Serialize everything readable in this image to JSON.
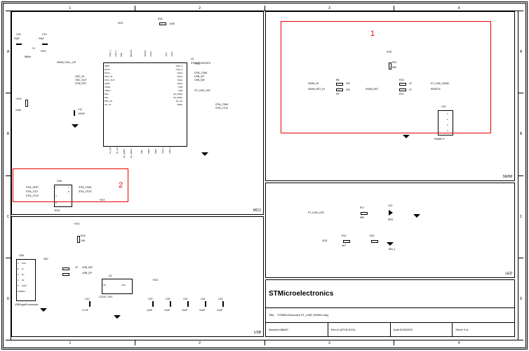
{
  "frame": {
    "cols": [
      "1",
      "2",
      "3",
      "4"
    ],
    "rows": [
      "A",
      "B",
      "C",
      "D"
    ]
  },
  "title_block": {
    "company": "STMicroelectronics",
    "title_label": "Title:",
    "title": "STM8S-Discovery ST_LINK (SWIM only)",
    "number_label": "Number:",
    "number": "MB867",
    "rev_label": "Rev:",
    "rev": "A.1(PCB.SCH)",
    "date_label": "Date:",
    "date": "6/25/2009",
    "sheet_label": "Sheet 3",
    "sheet_of": "of"
  },
  "blocks": {
    "mcu": {
      "label": "MCU",
      "ic_ref": "U2",
      "ic_part": "STM32F103C8T6"
    },
    "swim": {
      "label": "SWIM",
      "cn": "CN7",
      "cn_part": "Header 4",
      "pins": [
        "1",
        "2",
        "3",
        "4"
      ],
      "vdd": "VDD",
      "r12_val": "680",
      "r12": "R12"
    },
    "led": {
      "label": "LED",
      "ld_ref": "LD2",
      "ld_color": "RED",
      "ain1": "AIN_1"
    },
    "usb": {
      "label": "USB",
      "cn": "CN6",
      "conn_type": "USB-typeB connector",
      "reg": "U4",
      "reg_part": "LD1117-3V3",
      "reg_in": "Vin",
      "reg_out": "Vout"
    }
  },
  "highlights": {
    "one": "1",
    "two": "2"
  },
  "nets": {
    "swim_in": "SWIM_IN",
    "swim_rst_in": "SWIM_RST_IN",
    "swim_rst": "SWIM_RST",
    "st_link_swim": "ST_LINK_SWIM",
    "resetb": "RESET#",
    "st_link_led": "ST_LINK_LED",
    "vdd": "VDD",
    "r8": "R8",
    "r9": "R9",
    "r13": "R13",
    "r14": "R14",
    "r_220a": "220",
    "r_220b": "220",
    "r_47a": "47",
    "r_47b": "47",
    "r17": "R17",
    "r17_val": "680",
    "r19": "R19",
    "r19_val": "4K7",
    "r20": "R20",
    "swim_pull_up": "SWIM_PULL_UP",
    "osc_in": "OSC_IN",
    "osc_out": "OSC_OUT",
    "stm_rst": "STM_RST",
    "r18": "R18",
    "r18_val": "1K5",
    "u5v": "U5V",
    "usb_dm": "USB_DM",
    "usb_dp": "USB_DP",
    "r_22": "22",
    "p3v3": "+3V3",
    "p5v": "+5V",
    "x1": "X1",
    "x1_val": "8MHz",
    "c11": "C11",
    "c11_val": "100nF",
    "c18": "C18",
    "c18_val": "20pF",
    "c19": "C19",
    "c19_val": "20pF",
    "c10": "C10",
    "c10_val": "4.7uF",
    "c29": "C29",
    "c30": "C30",
    "c31": "C31",
    "c32": "C32",
    "c33": "C33",
    "c_val_10up": "10uP",
    "r15": "R15",
    "r15_val": "100K",
    "vcc": "VCC",
    "dm": "D-",
    "dp": "D+",
    "id": "ID",
    "gnd": "GND",
    "shell": "SHELL",
    "cn5": "CN5",
    "jtag": "JTAG",
    "stm_jrst": "STM_JRST",
    "stm_jtdi": "STM_JTDI",
    "stm_jtck": "STM_JTCK",
    "stm_jtms": "STM_JTMS",
    "stm_jtdo": "STM_JTDO",
    "vbat": "VBAT",
    "pc13": "PC13",
    "pc14": "PC14",
    "nrst": "nRST",
    "vssa": "VSSA",
    "vdda": "VDDA",
    "pa0": "PA0",
    "pa1": "PA1",
    "mis_cs": "MIS_CS",
    "vdd3": "VDD_3",
    "vss3": "VSS_3",
    "pb9": "PB9",
    "boot0": "BOOT0",
    "jnrst": "JNRST",
    "jtdo": "JTDO",
    "jtdi": "JTDI",
    "jtck": "JTCK",
    "vdd2": "VDD_2",
    "vss2": "VSS_2",
    "pa13": "PA13",
    "pa12": "PA12",
    "pa11": "PA11",
    "pa10": "PA10",
    "pa9": "PA9",
    "pa8": "PA8",
    "s2_mosi": "S2_MOSI",
    "s2_miso": "S2_MISO",
    "s2_ck": "S2_CK",
    "pb12": "PB12",
    "usb_dp_n": "USB_DP",
    "usb_dm_n": "USB_DM",
    "u2_tx": "U2_TX",
    "u2_rx": "U2_RX",
    "s1_ck": "S1_CK",
    "s1_miso": "S1_MISO",
    "s1_mosi": "S1_MOSI",
    "pb1": "PB1",
    "pb10": "PB10",
    "pb11": "PB11",
    "vss1": "VSS_1",
    "vdd1": "VDD_1",
    "pin1": "1",
    "pin2": "2",
    "pin3": "3",
    "pin4": "4",
    "pin5": "5",
    "pin6": "6",
    "pin7": "7",
    "pin8": "8"
  }
}
